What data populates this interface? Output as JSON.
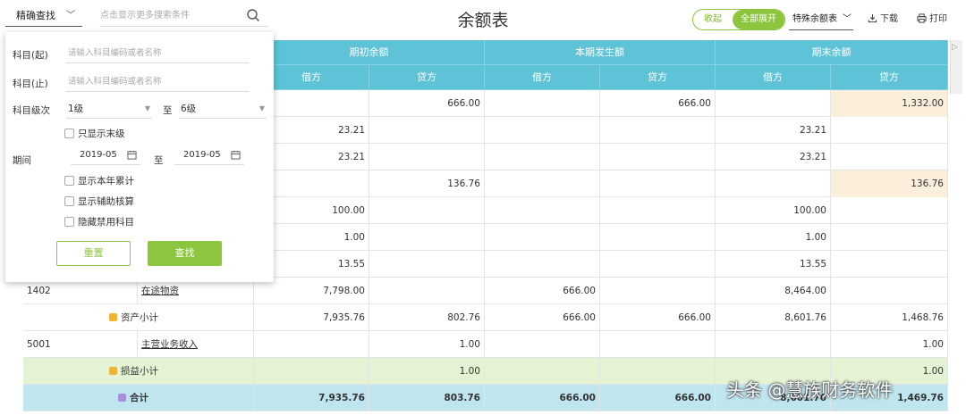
{
  "topbar": {
    "search_mode": "精确查找",
    "search_hint": "点击显示更多搜索条件",
    "title": "余额表",
    "collapse": "收起",
    "expand_all": "全部展开",
    "special": "特殊余额表",
    "download": "下载",
    "print": "打印"
  },
  "header": {
    "opening": "期初余额",
    "period": "本期发生额",
    "closing": "期末余额",
    "debit": "借方",
    "credit": "贷方"
  },
  "rows": [
    {
      "code": "",
      "name": "",
      "c": [
        "",
        "666.00",
        "",
        "666.00",
        "",
        "1,332.00"
      ]
    },
    {
      "code": "",
      "name": "",
      "c": [
        "23.21",
        "",
        "",
        "",
        "23.21",
        ""
      ]
    },
    {
      "code": "",
      "name": "",
      "c": [
        "23.21",
        "",
        "",
        "",
        "23.21",
        ""
      ]
    },
    {
      "code": "",
      "name": "",
      "c": [
        "",
        "136.76",
        "",
        "",
        "",
        "136.76"
      ]
    },
    {
      "code": "",
      "name": "",
      "c": [
        "100.00",
        "",
        "",
        "",
        "100.00",
        ""
      ]
    },
    {
      "code": "",
      "name": "",
      "c": [
        "1.00",
        "",
        "",
        "",
        "1.00",
        ""
      ]
    },
    {
      "code": "",
      "name": "",
      "c": [
        "13.55",
        "",
        "",
        "",
        "13.55",
        ""
      ]
    },
    {
      "code": "1402",
      "name": "在途物资",
      "c": [
        "7,798.00",
        "",
        "666.00",
        "",
        "8,464.00",
        ""
      ]
    },
    {
      "code": "",
      "name": "资产小计",
      "c": [
        "7,935.76",
        "802.76",
        "666.00",
        "666.00",
        "8,601.76",
        "1,468.76"
      ]
    },
    {
      "code": "5001",
      "name": "主营业务收入",
      "c": [
        "",
        "1.00",
        "",
        "",
        "",
        "1.00"
      ]
    },
    {
      "code": "",
      "name": "损益小计",
      "c": [
        "",
        "1.00",
        "",
        "",
        "",
        "1.00"
      ]
    },
    {
      "code": "",
      "name": "合计",
      "c": [
        "7,935.76",
        "803.76",
        "666.00",
        "666.00",
        "8,601.76",
        "1,469.76"
      ]
    }
  ],
  "panel": {
    "subject_from_label": "科目(起)",
    "subject_to_label": "科目(止)",
    "subject_placeholder": "请输入科目编码或者名称",
    "level_label": "科目级次",
    "level_from": "1级",
    "to": "至",
    "level_to": "6级",
    "only_leaf": "只显示末级",
    "period_label": "期间",
    "period_from": "2019-05",
    "period_to": "2019-05",
    "show_ytd": "显示本年累计",
    "show_aux": "显示辅助核算",
    "hide_disabled": "隐藏禁用科目",
    "reset": "重置",
    "search": "查找"
  },
  "watermark": "头条 @慧族财务软件",
  "colors": {
    "accent": "#8cc63f",
    "header": "#5ec3d7",
    "beige": "#fbefdc",
    "green_row": "#e3f3d4",
    "blue_row": "#bfe5ee"
  }
}
